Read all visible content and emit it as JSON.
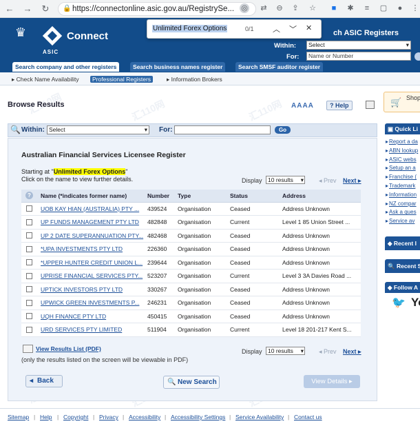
{
  "browser": {
    "url": "https://connectonline.asic.gov.au/RegistrySe...",
    "find_text": "Unlimited Forex Options",
    "find_count": "0/1"
  },
  "header": {
    "logo_text": "Connect",
    "logo_sub": "ASIC",
    "title": "ch ASIC Registers",
    "within_label": "Within:",
    "within_value": "Select",
    "for_label": "For:",
    "for_placeholder": "Name or Number",
    "tabs": [
      "Search company and other registers",
      "Search business names register",
      "Search SMSF auditor register"
    ],
    "subnav": [
      "Check Name Availability",
      "Professional Registers",
      "Information Brokers"
    ]
  },
  "main": {
    "title": "Browse Results",
    "text_size": "AAAA",
    "help_label": "Help",
    "shop_label": "Shop",
    "within_label": "Within:",
    "within_value": "Select",
    "for_label": "For:",
    "go_label": "Go",
    "register_title": "Australian Financial Services Licensee Register",
    "starting_prefix": "Starting at \"",
    "starting_value": "Unlimited Forex Options",
    "starting_suffix": "\"",
    "click_note": "Click on the name to view further details.",
    "display_label": "Display",
    "display_value": "10 results",
    "prev_label": "Prev",
    "next_label": "Next",
    "columns": [
      "?",
      "Name (*indicates former name)",
      "Number",
      "Type",
      "Status",
      "Address"
    ],
    "rows": [
      {
        "name": "UOB KAY HIAN (AUSTRALIA) PTY ...",
        "number": "439524",
        "type": "Organisation",
        "status": "Ceased",
        "address": "Address Unknown"
      },
      {
        "name": "UP FUNDS MANAGEMENT PTY LTD",
        "number": "482848",
        "type": "Organisation",
        "status": "Current",
        "address": "Level 1 85 Union Street ..."
      },
      {
        "name": "UP 2 DATE SUPERANNUATION PTY...",
        "number": "482468",
        "type": "Organisation",
        "status": "Ceased",
        "address": "Address Unknown"
      },
      {
        "name": "*UPA INVESTMENTS PTY LTD",
        "number": "226360",
        "type": "Organisation",
        "status": "Ceased",
        "address": "Address Unknown"
      },
      {
        "name": "*UPPER HUNTER CREDIT UNION L...",
        "number": "239644",
        "type": "Organisation",
        "status": "Ceased",
        "address": "Address Unknown"
      },
      {
        "name": "UPRISE FINANCIAL SERVICES PTY...",
        "number": "523207",
        "type": "Organisation",
        "status": "Current",
        "address": "Level 3 3A Davies Road ..."
      },
      {
        "name": "UPTICK INVESTORS PTY LTD",
        "number": "330267",
        "type": "Organisation",
        "status": "Ceased",
        "address": "Address Unknown"
      },
      {
        "name": "UPWICK GREEN INVESTMENTS P...",
        "number": "246231",
        "type": "Organisation",
        "status": "Ceased",
        "address": "Address Unknown"
      },
      {
        "name": "UQH FINANCE PTY LTD",
        "number": "450415",
        "type": "Organisation",
        "status": "Ceased",
        "address": "Address Unknown"
      },
      {
        "name": "URD SERVICES PTY LIMITED",
        "number": "511904",
        "type": "Organisation",
        "status": "Current",
        "address": "Level 18 201-217 Kent S..."
      }
    ],
    "pdf_link": "View Results List (PDF)",
    "pdf_note": "(only the results listed on the screen will be viewable in PDF)",
    "back_label": "Back",
    "new_search_label": "New Search",
    "view_details_label": "View Details"
  },
  "right": {
    "quick_title": "Quick Li",
    "quick_links": [
      "Report a da",
      "ABN lookup",
      "ASIC webs",
      "Setup an a",
      "Franchise (",
      "Trademark",
      "Information",
      "NZ compar",
      "Ask a ques",
      "Service av"
    ],
    "recent_title": "Recent I",
    "recent_search_title": "Recent S",
    "follow_title": "Follow A",
    "follow_text": "Yo"
  },
  "footer": {
    "links": [
      "Sitemap",
      "Help",
      "Copyright",
      "Privacy",
      "Accessibility",
      "Accessibility Settings",
      "Service Availability",
      "Contact us"
    ]
  },
  "watermark_text": "汇110网"
}
